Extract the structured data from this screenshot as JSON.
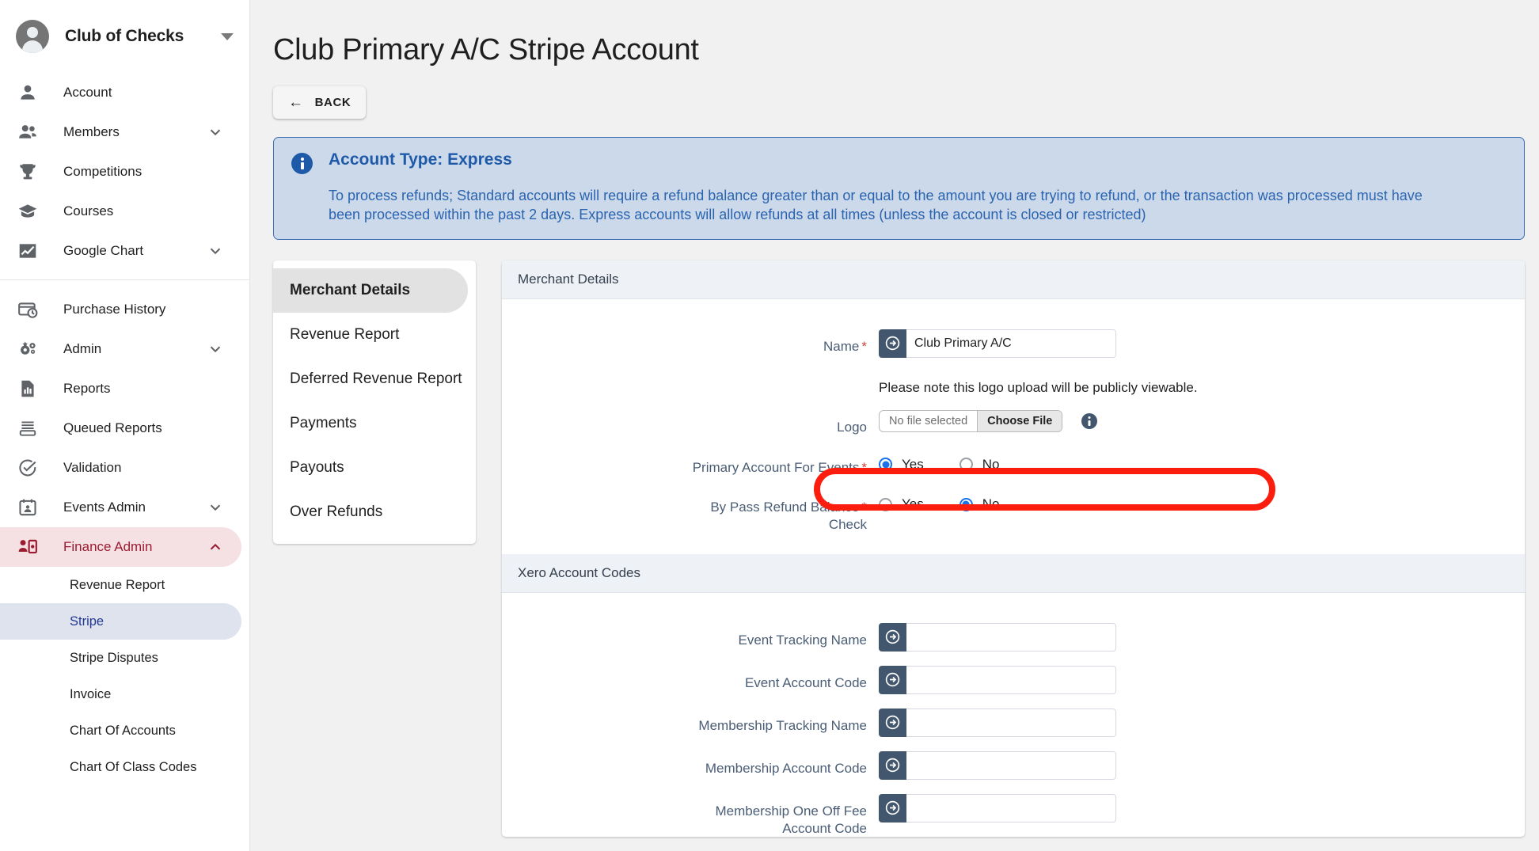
{
  "sidebar": {
    "brand": {
      "name": "Club of Checks",
      "avatar_icon": "user-avatar-icon",
      "caret_icon": "caret-down-icon"
    },
    "items_top": [
      {
        "label": "Account",
        "icon": "person-icon",
        "expandable": false
      },
      {
        "label": "Members",
        "icon": "people-icon",
        "expandable": true
      },
      {
        "label": "Competitions",
        "icon": "trophy-icon",
        "expandable": false
      },
      {
        "label": "Courses",
        "icon": "graduation-cap-icon",
        "expandable": false
      },
      {
        "label": "Google Chart",
        "icon": "line-chart-icon",
        "expandable": true
      }
    ],
    "items_bottom": [
      {
        "label": "Purchase History",
        "icon": "card-clock-icon",
        "expandable": false
      },
      {
        "label": "Admin",
        "icon": "gears-icon",
        "expandable": true
      },
      {
        "label": "Reports",
        "icon": "report-doc-icon",
        "expandable": false
      },
      {
        "label": "Queued Reports",
        "icon": "queue-icon",
        "expandable": false
      },
      {
        "label": "Validation",
        "icon": "check-circle-icon",
        "expandable": false
      },
      {
        "label": "Events Admin",
        "icon": "calendar-person-icon",
        "expandable": true
      },
      {
        "label": "Finance Admin",
        "icon": "person-money-icon",
        "expandable": true,
        "active": true,
        "expanded": true
      }
    ],
    "finance_subitems": [
      {
        "label": "Revenue Report",
        "active": false
      },
      {
        "label": "Stripe",
        "active": true
      },
      {
        "label": "Stripe Disputes",
        "active": false
      },
      {
        "label": "Invoice",
        "active": false
      },
      {
        "label": "Chart Of Accounts",
        "active": false
      },
      {
        "label": "Chart Of Class Codes",
        "active": false
      }
    ],
    "colors": {
      "active_finance_bg": "#f5e1e4",
      "active_finance_text": "#9b1c31",
      "active_sub_bg": "#dfe3ee",
      "active_sub_text": "#22398f"
    }
  },
  "header": {
    "title": "Club Primary A/C Stripe Account",
    "back_label": "BACK",
    "back_icon": "arrow-left-icon"
  },
  "alert": {
    "icon": "info-circle-icon",
    "title": "Account Type: Express",
    "text": "To process refunds; Standard accounts will require a refund balance greater than or equal to the amount you are trying to refund, or the transaction was processed must have been processed within the past 2 days. Express accounts will allow refunds at all times (unless the account is closed or restricted)",
    "color": "#1e5aa8",
    "bg": "#ccd9eb"
  },
  "tabs": [
    {
      "label": "Merchant Details",
      "active": true
    },
    {
      "label": "Revenue Report",
      "active": false
    },
    {
      "label": "Deferred Revenue Report",
      "active": false
    },
    {
      "label": "Payments",
      "active": false
    },
    {
      "label": "Payouts",
      "active": false
    },
    {
      "label": "Over Refunds",
      "active": false
    }
  ],
  "merchant_section": {
    "heading": "Merchant Details",
    "name_label": "Name",
    "name_value": "Club Primary A/C",
    "name_placeholder": "",
    "logo_note": "Please note this logo upload will be publicly viewable.",
    "logo_label": "Logo",
    "file_name": "No file selected",
    "choose_file_label": "Choose File",
    "primary_account_label": "Primary Account For Events",
    "primary_account_yes": "Yes",
    "primary_account_no": "No",
    "primary_account_selected": "Yes",
    "bypass_label_line1": "By Pass Refund Balance",
    "bypass_label_line2": "Check",
    "bypass_yes": "Yes",
    "bypass_no": "No",
    "bypass_selected": "No"
  },
  "xero_section": {
    "heading": "Xero Account Codes",
    "fields": [
      {
        "label": "Event Tracking Name",
        "value": ""
      },
      {
        "label": "Event Account Code",
        "value": ""
      },
      {
        "label": "Membership Tracking Name",
        "value": ""
      },
      {
        "label": "Membership Account Code",
        "value": ""
      },
      {
        "label": "Membership One Off Fee Account Code",
        "value": "",
        "line1": "Membership One Off Fee",
        "line2": "Account Code"
      }
    ]
  },
  "annotation": {
    "shape": "red-oval-highlight",
    "target": "primary-account-for-events-row",
    "color": "#fb1d0d"
  }
}
